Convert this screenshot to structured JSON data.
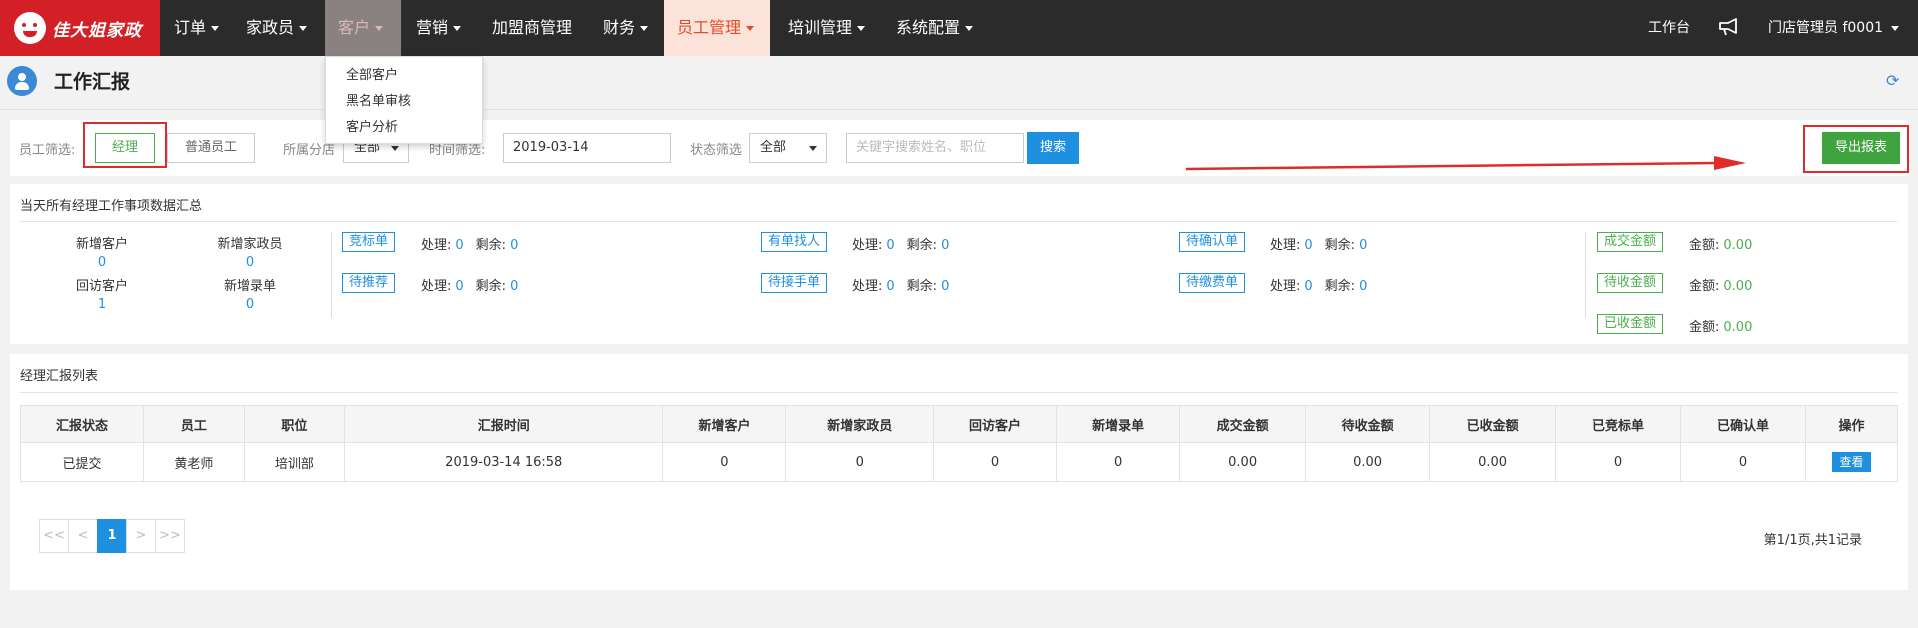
{
  "brand": {
    "logo_text": "佳大姐家政"
  },
  "nav": {
    "items": [
      {
        "label": "订单"
      },
      {
        "label": "家政员"
      },
      {
        "label": "客户"
      },
      {
        "label": "营销"
      },
      {
        "label": "加盟商管理"
      },
      {
        "label": "财务"
      },
      {
        "label": "员工管理"
      },
      {
        "label": "培训管理"
      },
      {
        "label": "系统配置"
      }
    ],
    "workbench": "工作台",
    "user": "门店管理员 f0001"
  },
  "customer_menu": {
    "items": [
      "全部客户",
      "黑名单审核",
      "客户分析"
    ]
  },
  "page": {
    "title": "工作汇报"
  },
  "filters": {
    "staff_label": "员工筛选:",
    "manager_btn": "经理",
    "normal_btn": "普通员工",
    "branch_label": "所属分店",
    "branch_value": "全部",
    "time_label": "时间筛选:",
    "date_value": "2019-03-14",
    "status_label": "状态筛选",
    "status_value": "全部",
    "search_placeholder": "关键字搜索姓名、职位",
    "search_btn": "搜索",
    "export_btn": "导出报表"
  },
  "summary": {
    "title": "当天所有经理工作事项数据汇总",
    "stats": [
      {
        "label": "新增客户",
        "value": "0"
      },
      {
        "label": "新增家政员",
        "value": "0"
      },
      {
        "label": "回访客户",
        "value": "1"
      },
      {
        "label": "新增录单",
        "value": "0"
      }
    ],
    "process_label": "处理:",
    "remain_label": "剩余:",
    "tasks": [
      {
        "tag": "竞标单",
        "processed": "0",
        "remaining": "0"
      },
      {
        "tag": "有单找人",
        "processed": "0",
        "remaining": "0"
      },
      {
        "tag": "待确认单",
        "processed": "0",
        "remaining": "0"
      },
      {
        "tag": "待推荐",
        "processed": "0",
        "remaining": "0"
      },
      {
        "tag": "待接手单",
        "processed": "0",
        "remaining": "0"
      },
      {
        "tag": "待缴费单",
        "processed": "0",
        "remaining": "0"
      }
    ],
    "amount_label": "金额:",
    "amounts": [
      {
        "tag": "成交金额",
        "value": "0.00"
      },
      {
        "tag": "待收金额",
        "value": "0.00"
      },
      {
        "tag": "已收金额",
        "value": "0.00"
      }
    ]
  },
  "report_list": {
    "title": "经理汇报列表",
    "columns": [
      "汇报状态",
      "员工",
      "职位",
      "汇报时间",
      "新增客户",
      "新增家政员",
      "回访客户",
      "新增录单",
      "成交金额",
      "待收金额",
      "已收金额",
      "已竞标单",
      "已确认单",
      "操作"
    ],
    "rows": [
      {
        "status": "已提交",
        "employee": "黄老师",
        "position": "培训部",
        "time": "2019-03-14 16:58",
        "new_customers": "0",
        "new_workers": "0",
        "revisits": "0",
        "new_orders": "0",
        "deal_amount": "0.00",
        "pending_amount": "0.00",
        "received_amount": "0.00",
        "bid_orders": "0",
        "confirmed_orders": "0",
        "action": "查看"
      }
    ],
    "pagination": {
      "first": "<<",
      "prev": "<",
      "current": "1",
      "next": ">",
      "last": ">>",
      "info": "第1/1页,共1记录"
    }
  },
  "colors": {
    "nav_bg": "#2b2b2b",
    "brand_red": "#d32027",
    "primary_blue": "#1f8fdf",
    "success_green": "#3fa33f",
    "highlight_red": "#e02b2b"
  }
}
